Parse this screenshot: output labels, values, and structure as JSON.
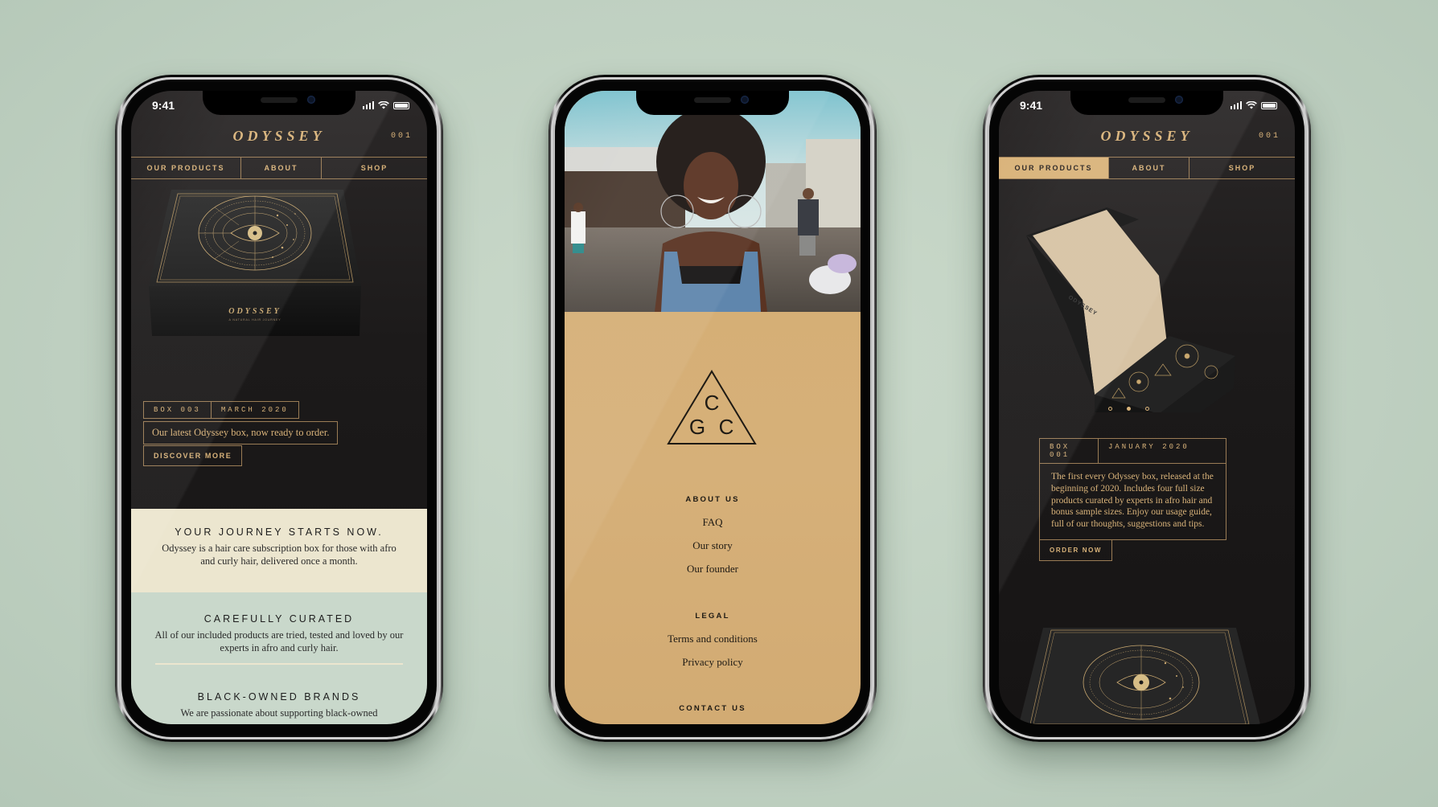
{
  "status_bar": {
    "time": "9:41"
  },
  "phones": [
    {
      "brand": "ODYSSEY",
      "issue": "001",
      "nav": [
        "OUR PRODUCTS",
        "ABOUT",
        "SHOP"
      ],
      "active_tab": null,
      "product_image": {
        "brand": "ODYSSEY",
        "tagline": "A NATURAL HAIR JOURNEY"
      },
      "tags": [
        "BOX 003",
        "MARCH 2020"
      ],
      "description": "Our latest Odyssey box, now ready to order.",
      "cta": "DISCOVER MORE",
      "sections": [
        {
          "title": "YOUR JOURNEY STARTS NOW.",
          "body": "Odyssey is a hair care subscription box for those with afro and curly hair, delivered once a month."
        },
        {
          "title": "CAREFULLY CURATED",
          "body": "All of our included products are tried, tested and loved by our experts in afro and curly hair."
        },
        {
          "title": "BLACK-OWNED BRANDS",
          "body": "We are passionate about supporting black-owned"
        }
      ]
    },
    {
      "hero_image": "Smiling woman with afro hair in denim overalls at an outdoor market",
      "logo": {
        "top": "C",
        "bottom_left": "G",
        "bottom_right": "C"
      },
      "footer": [
        {
          "heading": "ABOUT US",
          "links": [
            "FAQ",
            "Our story",
            "Our founder"
          ]
        },
        {
          "heading": "LEGAL",
          "links": [
            "Terms and conditions",
            "Privacy policy"
          ]
        },
        {
          "heading": "CONTACT US",
          "links": []
        }
      ]
    },
    {
      "brand": "ODYSSEY",
      "issue": "001",
      "nav": [
        "OUR PRODUCTS",
        "ABOUT",
        "SHOP"
      ],
      "active_tab": "OUR PRODUCTS",
      "product_image": {
        "brand": "ODYSSEY"
      },
      "carousel": {
        "count": 3,
        "active": 2
      },
      "tags": [
        "BOX 001",
        "JANUARY 2020"
      ],
      "description": "The first every Odyssey box, released at the beginning of 2020. Includes four full size products curated by experts in afro hair and bonus sample sizes. Enjoy our usage guide, full of our thoughts, suggestions and tips.",
      "cta": "ORDER NOW"
    }
  ],
  "colors": {
    "background": "#c3d3c5",
    "gold": "#d9b37a",
    "dark_bg": "#1f1c1c",
    "tan": "#d4ad72",
    "cream": "#ece6cf",
    "mint": "#c9d8cb"
  }
}
